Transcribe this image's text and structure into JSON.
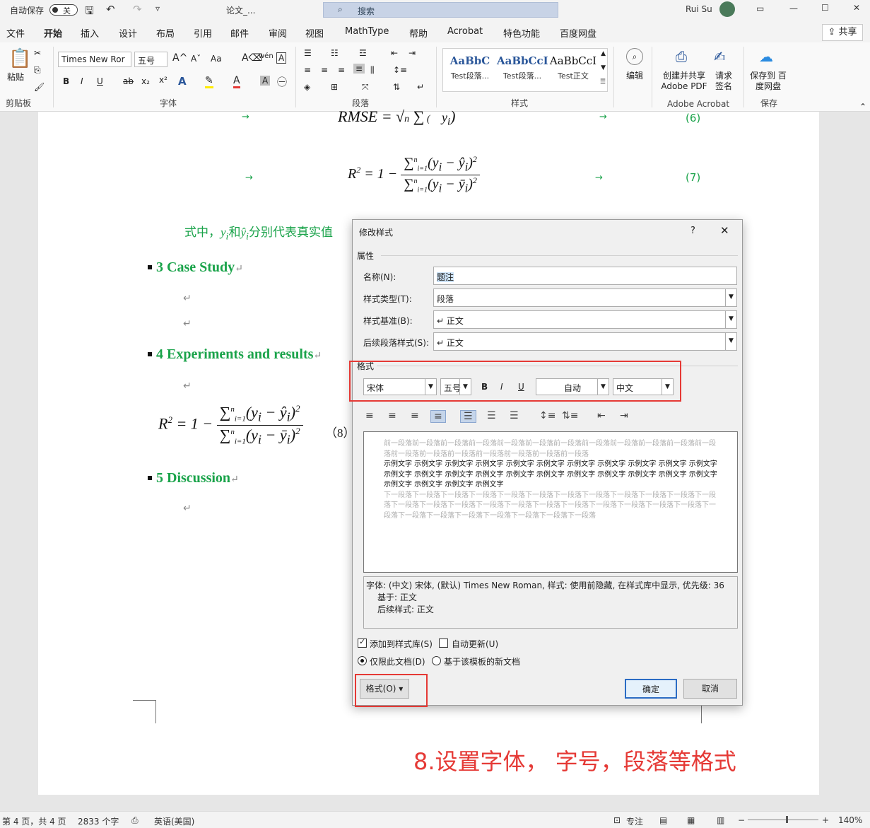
{
  "titlebar": {
    "autosave_label": "自动保存",
    "autosave_state": "关",
    "doc_name": "论文_...",
    "search_placeholder": "搜索",
    "user_name": "Rui Su"
  },
  "menu": {
    "tabs": [
      "文件",
      "开始",
      "插入",
      "设计",
      "布局",
      "引用",
      "邮件",
      "审阅",
      "视图",
      "MathType",
      "帮助",
      "Acrobat",
      "特色功能",
      "百度网盘"
    ],
    "active": "开始",
    "share_label": "共享"
  },
  "ribbon": {
    "paste_label": "粘贴",
    "clipboard_group": "剪贴板",
    "font_name": "Times New Ror",
    "font_size": "五号",
    "font_group": "字体",
    "paragraph_group": "段落",
    "styles_group": "样式",
    "style_items": [
      {
        "preview": "AaBbC",
        "name": "Test段落..."
      },
      {
        "preview": "AaBbCcI",
        "name": "Test段落..."
      },
      {
        "preview": "AaBbCcI",
        "name": "Test正文"
      }
    ],
    "edit_label": "编辑",
    "acrobat_create": "创建并共享 Adobe PDF",
    "acrobat_sign": "请求 签名",
    "acrobat_group": "Adobe Acrobat",
    "save_baidu": "保存到 百度网盘",
    "save_group": "保存"
  },
  "document": {
    "eq6_label": "(6)",
    "eq7_label": "(7)",
    "eq8_label": "（8）",
    "inline_text": "式中，",
    "inline_text2": "和",
    "inline_text3": "分别代表真实值",
    "headings": [
      "3 Case Study",
      "4 Experiments and results",
      "5 Discussion"
    ]
  },
  "dialog": {
    "title": "修改样式",
    "help": "?",
    "section_properties": "属性",
    "name_label": "名称(N):",
    "name_value": "题注",
    "type_label": "样式类型(T):",
    "type_value": "段落",
    "based_label": "样式基准(B):",
    "based_value": "↵ 正文",
    "next_label": "后续段落样式(S):",
    "next_value": "↵ 正文",
    "section_format": "格式",
    "font": "宋体",
    "size": "五号",
    "bold": "B",
    "italic": "I",
    "underline": "U",
    "color": "自动",
    "script": "中文",
    "preview_prev": "前一段落前一段落前一段落前一段落前一段落前一段落前一段落前一段落前一段落前一段落前一段落前一段落前一段落前一段落前一段落前一段落前一段落前一段落前一段落",
    "preview_sample": "示例文字 示例文字 示例文字 示例文字 示例文字 示例文字 示例文字 示例文字 示例文字 示例文字 示例文字 示例文字 示例文字 示例文字 示例文字 示例文字 示例文字 示例文字 示例文字 示例文字 示例文字 示例文字 示例文字 示例文字 示例文字 示例文字",
    "preview_next": "下一段落下一段落下一段落下一段落下一段落下一段落下一段落下一段落下一段落下一段落下一段落下一段落下一段落下一段落下一段落下一段落下一段落下一段落下一段落下一段落下一段落下一段落下一段落下一段落下一段落下一段落下一段落下一段落下一段落下一段落下一段落",
    "desc_line1": "字体: (中文) 宋体, (默认) Times New Roman, 样式: 使用前隐藏, 在样式库中显示, 优先级: 36",
    "desc_line2": "基于: 正文",
    "desc_line3": "后续样式: 正文",
    "add_gallery": "添加到样式库(S)",
    "auto_update": "自动更新(U)",
    "only_doc": "仅限此文档(D)",
    "new_template": "基于该模板的新文档",
    "format_btn": "格式(O) ▾",
    "ok": "确定",
    "cancel": "取消"
  },
  "annotation": "8.设置字体， 字号，段落等格式",
  "statusbar": {
    "page": "第 4 页，共 4 页",
    "words": "2833 个字",
    "lang": "英语(美国)",
    "focus": "专注",
    "zoom": "140%"
  },
  "colors": {
    "accent": "#2b579a",
    "heading_green": "#1aa34a",
    "annotation_red": "#e53935"
  }
}
